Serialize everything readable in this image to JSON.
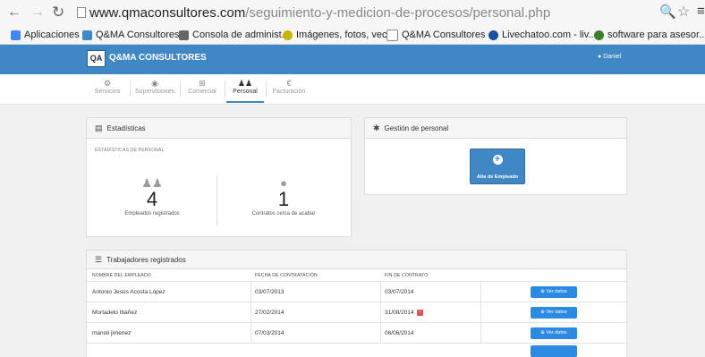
{
  "browser": {
    "url_host": "www.qmaconsultores.com",
    "url_path": "/seguimiento-y-medicion-de-procesos/personal.php",
    "bookmarks": [
      {
        "label": "Aplicaciones",
        "icon": "apps-grid-icon",
        "color": "#4285f4"
      },
      {
        "label": "Q&MA Consultores",
        "icon": "site-favicon-icon",
        "color": "#3f87c5"
      },
      {
        "label": "Consola de administ...",
        "icon": "settings-favicon-icon",
        "color": "#666666"
      },
      {
        "label": "Imágenes, fotos, vec...",
        "icon": "image-favicon-icon",
        "color": "#c9b400"
      },
      {
        "label": "Q&MA Consultores ...",
        "icon": "page-icon",
        "color": "#ffffff"
      },
      {
        "label": "Livechatoo.com - liv...",
        "icon": "chat-favicon-icon",
        "color": "#1a4fa0"
      },
      {
        "label": "software para asesor...",
        "icon": "shield-favicon-icon",
        "color": "#3a7d2c"
      }
    ]
  },
  "header": {
    "logo_text": "QA",
    "brand": "Q&MA CONSULTORES",
    "user": "Daniel",
    "accent": "#3f87c5"
  },
  "tabs": [
    {
      "label": "Servicios",
      "icon": "services-icon",
      "glyph": "⚙"
    },
    {
      "label": "Supervisiones",
      "icon": "eye-icon",
      "glyph": "👁"
    },
    {
      "label": "Comercial",
      "icon": "cart-icon",
      "glyph": "🛒"
    },
    {
      "label": "Personal",
      "icon": "users-icon",
      "glyph": "👥",
      "active": true
    },
    {
      "label": "Facturación",
      "icon": "euro-icon",
      "glyph": "€"
    }
  ],
  "stats": {
    "title": "Estadísticas",
    "subtitle": "ESTADÍSTICAS DE PERSONAL",
    "employees_count": "4",
    "employees_label": "Empleados registrados",
    "contracts_count": "1",
    "contracts_label": "Contratos cerca de acabar"
  },
  "gestion": {
    "title": "Gestión de personal",
    "button_label": "Alta de Empleado"
  },
  "workers": {
    "title": "Trabajadores registrados",
    "columns": [
      "NOMBRE DEL EMPLEADO",
      "FECHA DE CONTRATACIÓN",
      "FIN DE CONTRATO"
    ],
    "button_label": "Ver datos",
    "rows": [
      {
        "name": "Antonio Jesús Acosta López",
        "start": "03/07/2013",
        "end": "03/07/2014",
        "warn": false
      },
      {
        "name": "Mortadelo Ibañez",
        "start": "27/02/2014",
        "end": "31/08/2014",
        "warn": true
      },
      {
        "name": "manoli jimenez",
        "start": "07/03/2014",
        "end": "06/06/2014",
        "warn": false
      }
    ]
  }
}
